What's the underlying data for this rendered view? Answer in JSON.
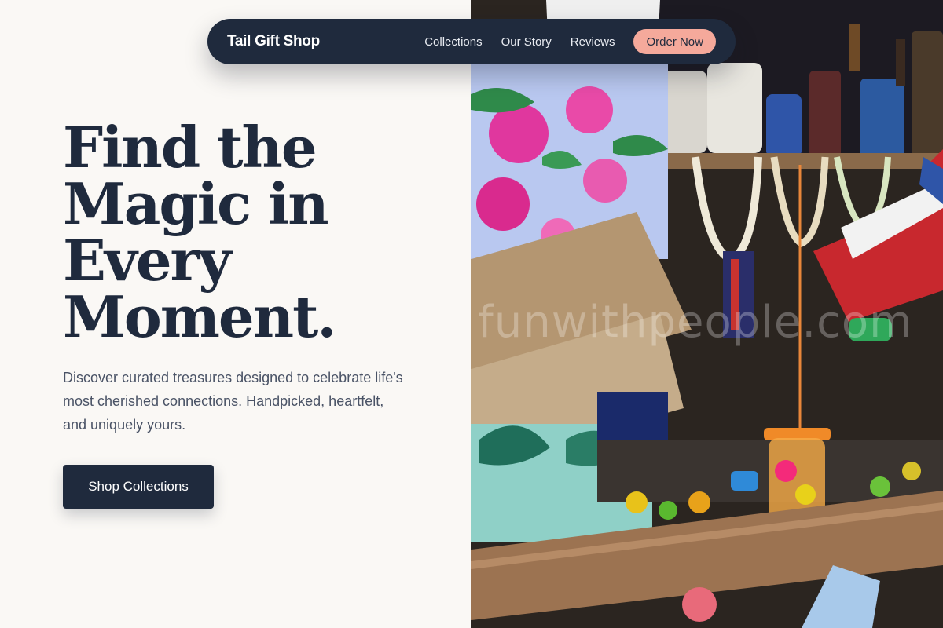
{
  "nav": {
    "brand": "Tail Gift Shop",
    "links": [
      "Collections",
      "Our Story",
      "Reviews"
    ],
    "order_label": "Order Now"
  },
  "hero": {
    "headline_lines": [
      "Find the",
      "Magic in",
      "Every",
      "Moment."
    ],
    "subtext": "Discover curated treasures designed to celebrate life's most cherished connections. Handpicked, heartfelt, and uniquely yours.",
    "cta_label": "Shop Collections"
  },
  "photo": {
    "watermark": "funwithpeople.com"
  },
  "colors": {
    "navy": "#1f2a3d",
    "accent_coral": "#f5a99b",
    "background": "#faf8f5",
    "body_text": "#4a5366"
  }
}
